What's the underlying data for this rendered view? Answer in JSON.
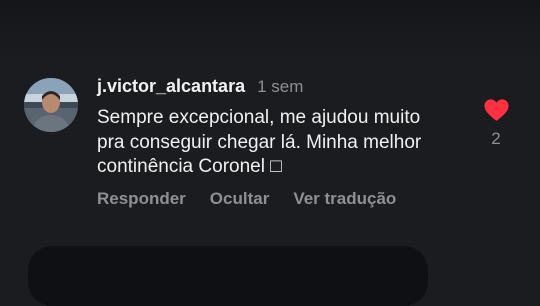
{
  "comment": {
    "username": "j.victor_alcantara",
    "time": "1 sem",
    "text_lines": [
      "Sempre excepcional, me ajudou muito",
      "pra conseguir chegar lá. Minha melhor",
      "continência Coronel □"
    ],
    "actions": {
      "reply": "Responder",
      "hide": "Ocultar",
      "translate": "Ver tradução"
    },
    "likes": {
      "count": "2",
      "liked": true,
      "heart_color": "#ff3040"
    }
  }
}
